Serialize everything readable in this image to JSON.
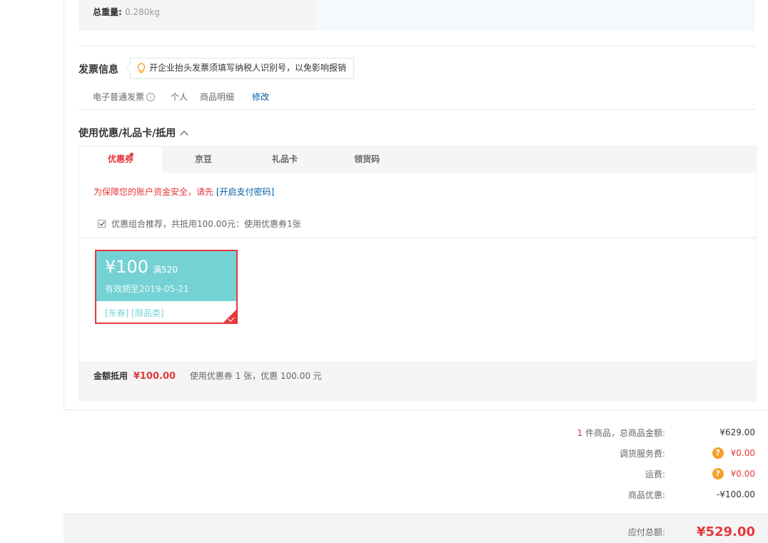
{
  "weight": {
    "label": "总重量:",
    "value": "0.280kg"
  },
  "invoice": {
    "title": "发票信息",
    "tip": "开企业抬头发票须填写纳税人识别号，以免影响报销",
    "type": "电子普通发票",
    "info_icon": "i",
    "owner": "个人",
    "detail": "商品明细",
    "edit": "修改"
  },
  "coupon_section": {
    "title": "使用优惠/礼品卡/抵用",
    "tabs": [
      {
        "label": "优惠券"
      },
      {
        "label": "京豆"
      },
      {
        "label": "礼品卡"
      },
      {
        "label": "领货码"
      }
    ],
    "warning": "为保障您的账户资金安全，请先",
    "warning_link": "[开启支付密码]",
    "combo_text": "优惠组合推荐，共抵用100.00元：使用优惠券1张",
    "card": {
      "amount": "¥100",
      "condition": "满520",
      "expiry": "有效期至2019-05-21",
      "tags": "[东券]  [限品类]"
    },
    "footer": {
      "label": "金额抵用",
      "money": "¥100.00",
      "desc": "使用优惠券 1 张，优惠 100.00 元"
    }
  },
  "summary": {
    "items_count": "1",
    "items_label": " 件商品，总商品金额:",
    "items_value": "¥629.00",
    "service_label": "调货服务费:",
    "service_value": "¥0.00",
    "shipping_label": "运费:",
    "shipping_value": "¥0.00",
    "discount_label": "商品优惠:",
    "discount_value": "-¥100.00",
    "help_icon": "?",
    "total_label": "应付总额:",
    "total_value": "¥529.00"
  },
  "colors": {
    "accent": "#e4393c",
    "coupon": "#74d2d4",
    "link": "#005ea7",
    "help": "#f4a02c"
  }
}
